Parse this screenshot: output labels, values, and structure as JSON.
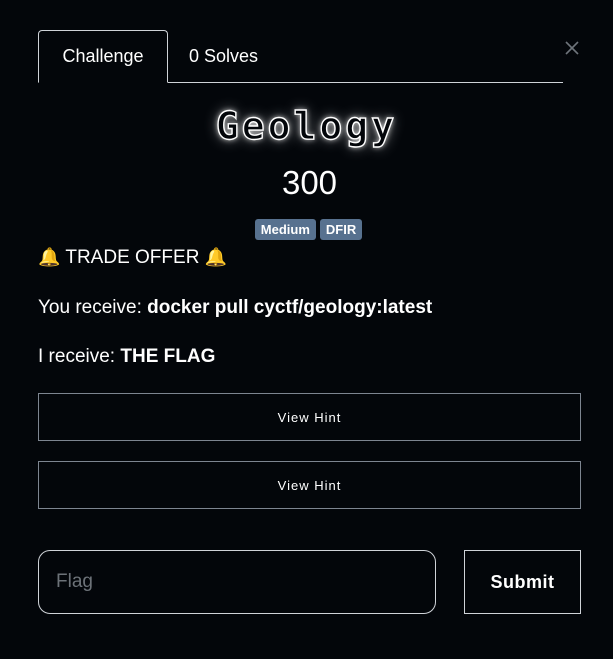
{
  "tabs": [
    {
      "label": "Challenge",
      "active": true
    },
    {
      "label": "0 Solves",
      "active": false
    }
  ],
  "challenge": {
    "name": "Geology",
    "points": "300",
    "tags": [
      "Medium",
      "DFIR"
    ],
    "description": {
      "line1": "TRADE OFFER",
      "line2_label": "You receive: ",
      "line2_value": "docker pull cyctf/geology:latest",
      "line3_label": "I receive: ",
      "line3_value": "THE FLAG"
    }
  },
  "hints": [
    {
      "label": "View Hint"
    },
    {
      "label": "View Hint"
    }
  ],
  "flag_form": {
    "placeholder": "Flag",
    "value": "",
    "submit_label": "Submit"
  },
  "icons": {
    "close": "close-icon",
    "bell": "bell-icon"
  },
  "colors": {
    "background": "#03060a",
    "badge": "#57718f",
    "border": "#cfd3d8"
  }
}
